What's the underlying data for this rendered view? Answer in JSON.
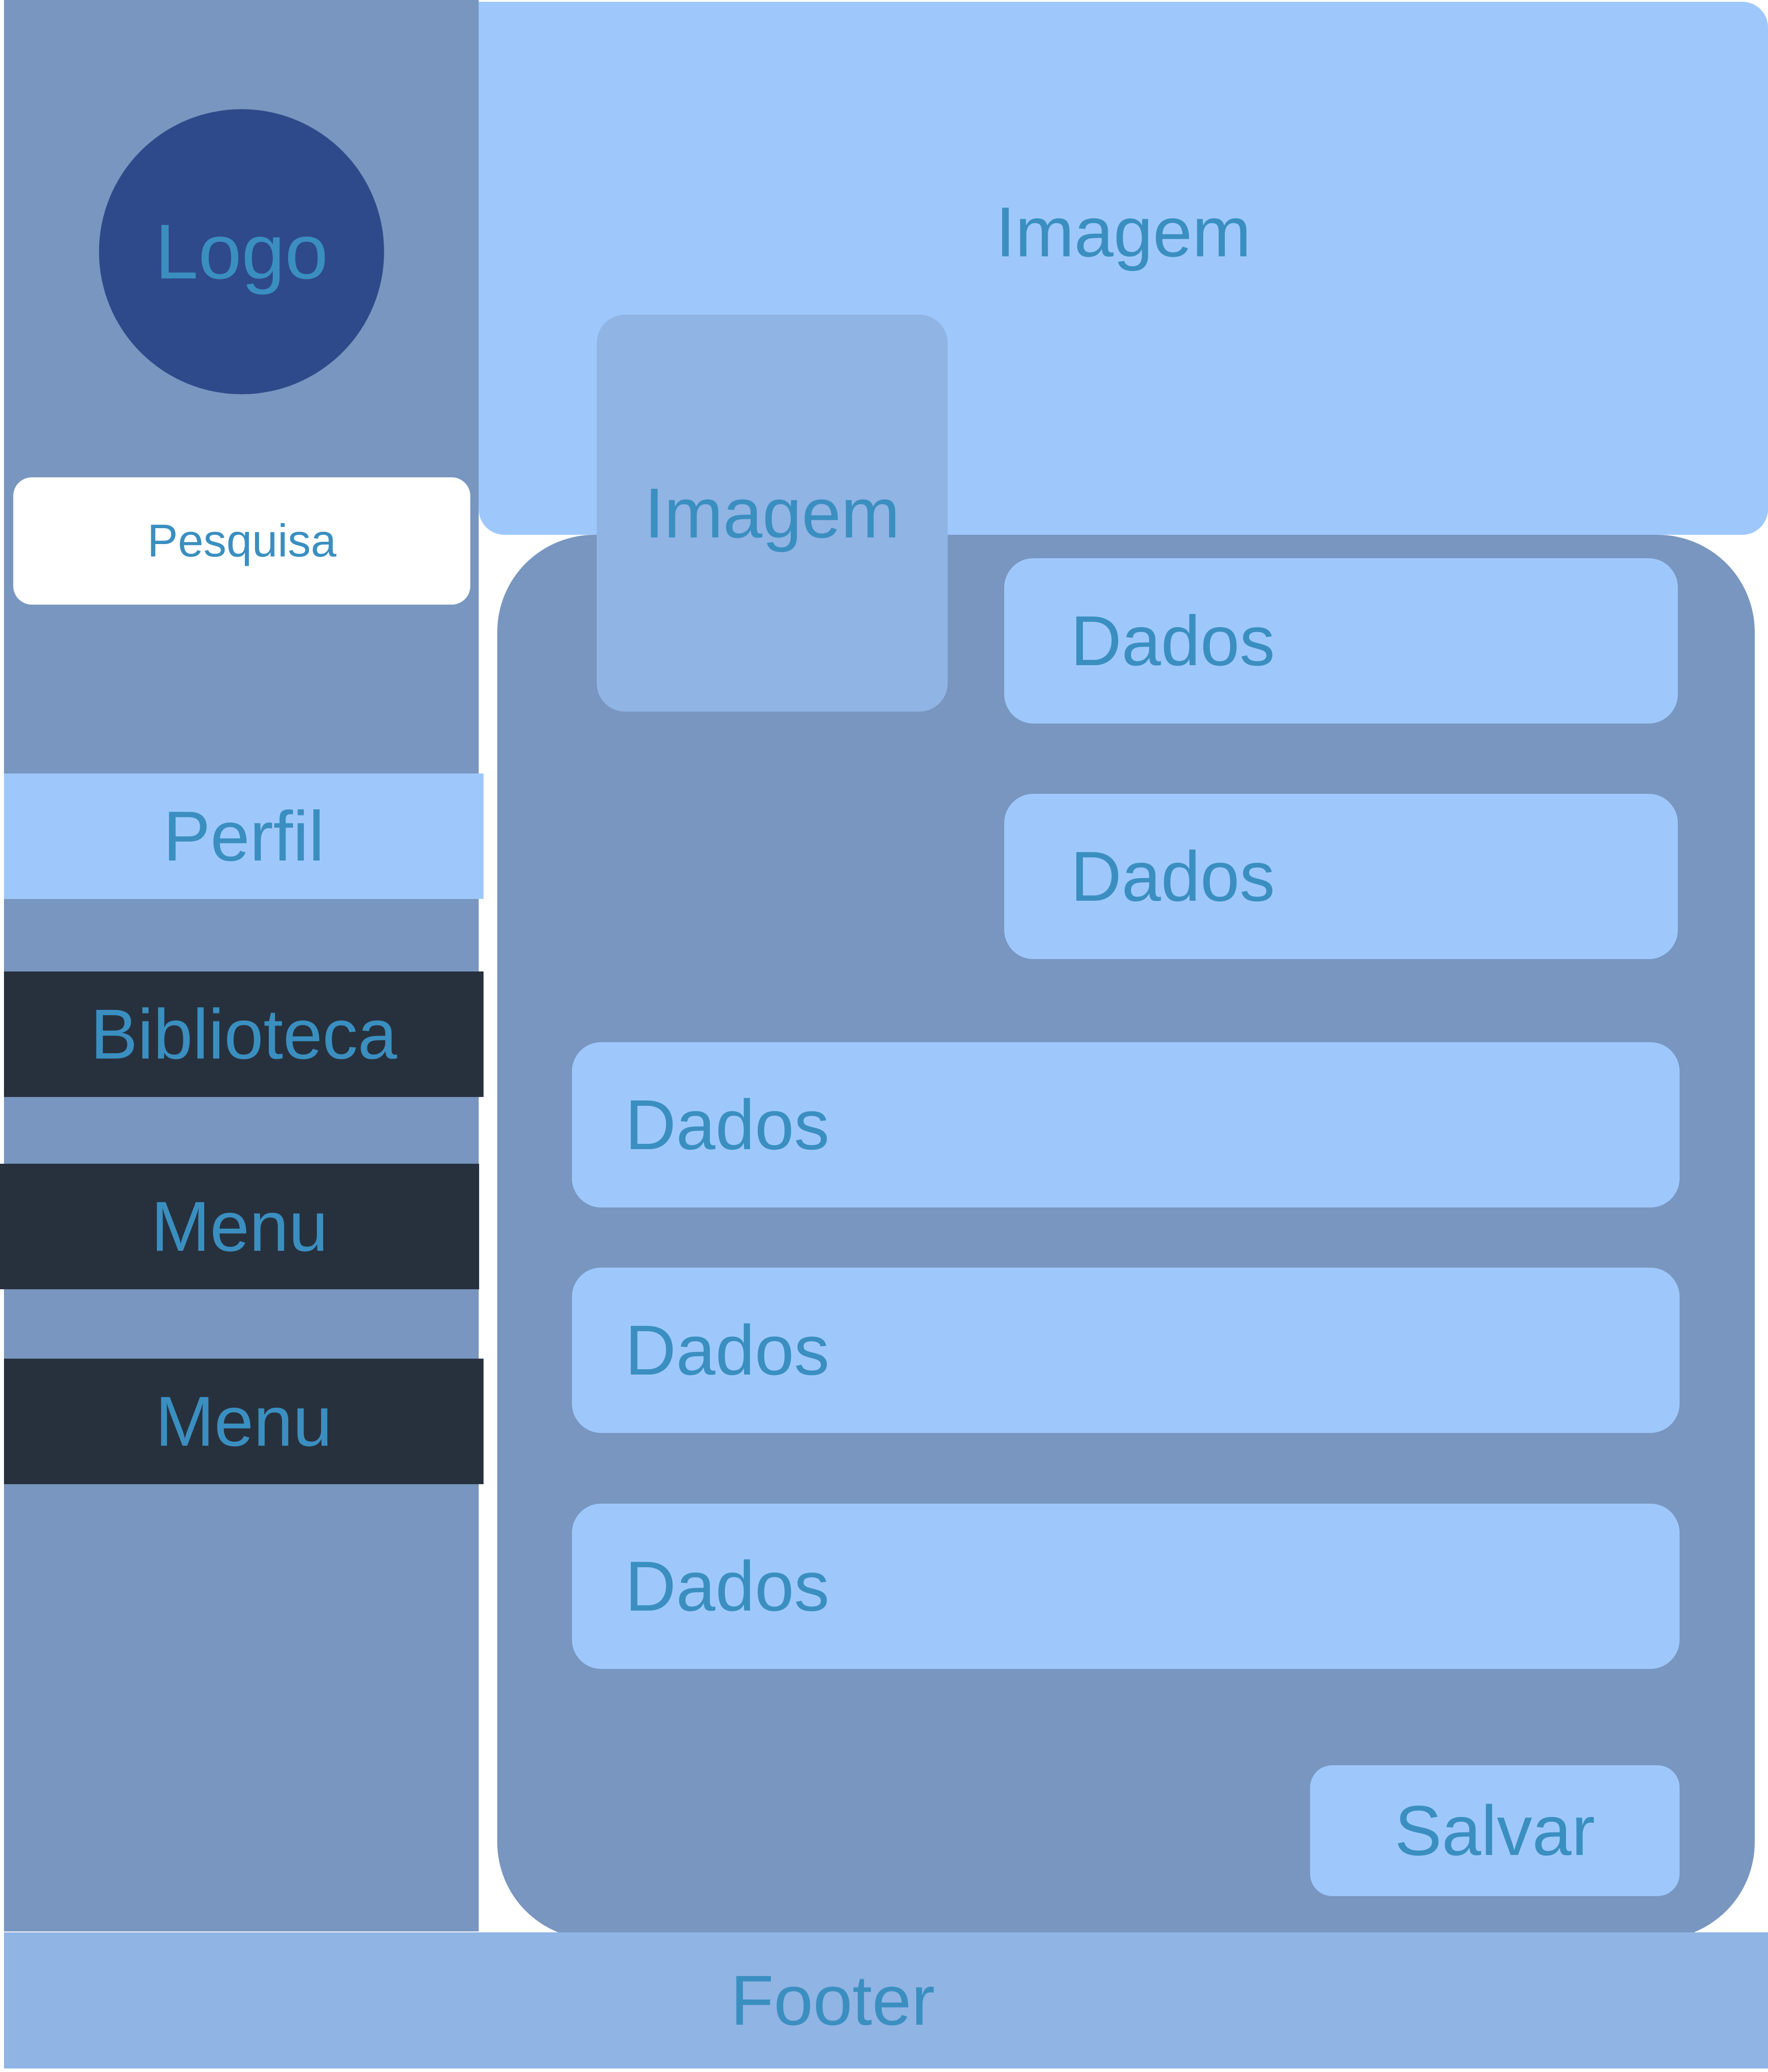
{
  "colors": {
    "sidebar_bg": "#7896bf",
    "logo_bg": "#2e4a8a",
    "nav_active_bg": "#9ec8fc",
    "nav_dark_bg": "#27313e",
    "light_bg": "#9ec8fc",
    "card_bg": "#7896bf",
    "image_bg": "#90b4e4",
    "footer_bg": "#90b4e4",
    "text": "#3a8fc0"
  },
  "sidebar": {
    "logo": "Logo",
    "search_label": "Pesquisa",
    "nav": [
      {
        "label": "Perfil",
        "active": true
      },
      {
        "label": "Biblioteca",
        "active": false
      },
      {
        "label": "Menu",
        "active": false
      },
      {
        "label": "Menu",
        "active": false
      }
    ]
  },
  "header": {
    "image_label": "Imagem"
  },
  "main": {
    "profile_image_label": "Imagem",
    "data_fields": [
      "Dados",
      "Dados",
      "Dados",
      "Dados",
      "Dados"
    ],
    "save_label": "Salvar"
  },
  "footer": {
    "label": "Footer"
  }
}
